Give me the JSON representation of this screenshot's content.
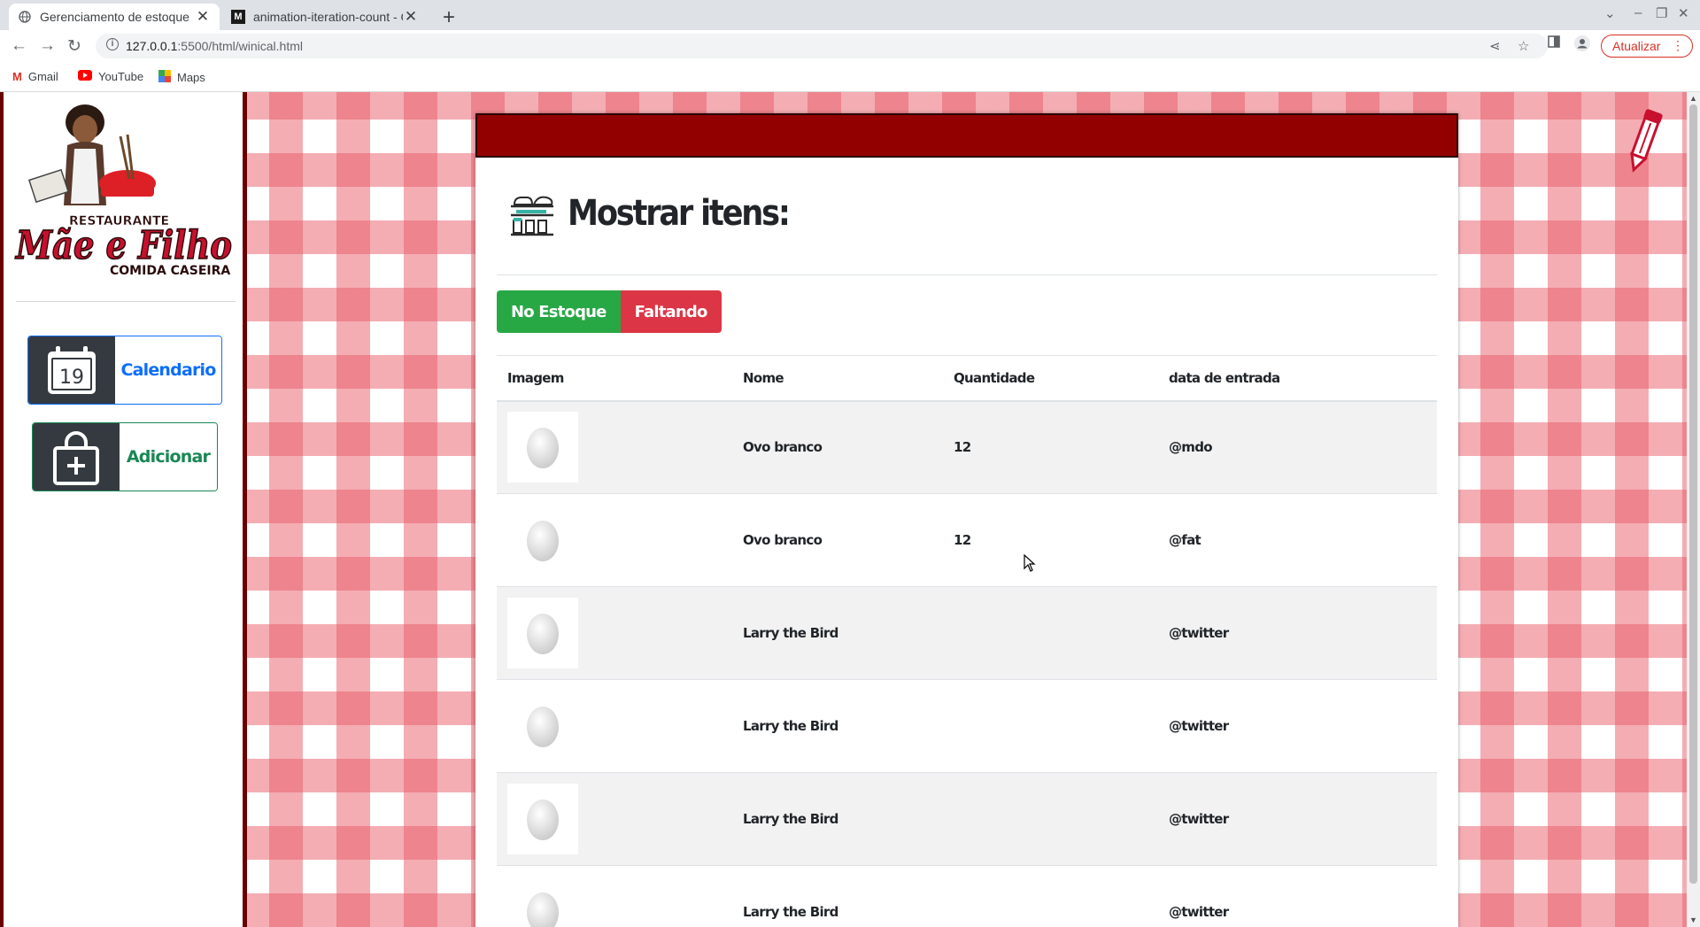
{
  "browser": {
    "tabs": [
      {
        "title": "Gerenciamento de estoque",
        "favicon": "globe-icon",
        "active": true
      },
      {
        "title": "animation-iteration-count - CS",
        "favicon": "mdn-icon",
        "active": false
      }
    ],
    "url_host": "127.0.0.1",
    "url_rest": ":5500/html/winical.html",
    "update_label": "Atualizar",
    "bookmarks": [
      {
        "label": "Gmail",
        "icon": "gmail-icon"
      },
      {
        "label": "YouTube",
        "icon": "youtube-icon"
      },
      {
        "label": "Maps",
        "icon": "maps-icon"
      }
    ]
  },
  "logo": {
    "top_text": "RESTAURANTE",
    "name": "Mãe e Filho",
    "tagline": "COMIDA CASEIRA"
  },
  "sidebar": {
    "calendar": {
      "label": "Calendario",
      "day": "19",
      "icon": "calendar-icon"
    },
    "add": {
      "label": "Adicionar",
      "icon": "shopping-bag-plus-icon"
    }
  },
  "main": {
    "title": "Mostrar itens:",
    "title_icon": "kitchen-shelf-icon",
    "filters": {
      "in_stock": "No Estoque",
      "missing": "Faltando"
    },
    "table": {
      "headers": {
        "image": "Imagem",
        "name": "Nome",
        "quantity": "Quantidade",
        "date": "data de entrada"
      },
      "rows": [
        {
          "name": "Ovo branco",
          "quantity": "12",
          "date": "@mdo"
        },
        {
          "name": "Ovo branco",
          "quantity": "12",
          "date": "@fat"
        },
        {
          "name": "Larry the Bird",
          "quantity": "",
          "date": "@twitter"
        },
        {
          "name": "Larry the Bird",
          "quantity": "",
          "date": "@twitter"
        },
        {
          "name": "Larry the Bird",
          "quantity": "",
          "date": "@twitter"
        },
        {
          "name": "Larry the Bird",
          "quantity": "",
          "date": "@twitter"
        }
      ]
    }
  },
  "colors": {
    "header_bar": "#930000",
    "sidebar_border": "#6b0000",
    "in_stock": "#28a745",
    "missing": "#dc3545",
    "calendar_accent": "#0d6efd",
    "add_accent": "#198754"
  }
}
